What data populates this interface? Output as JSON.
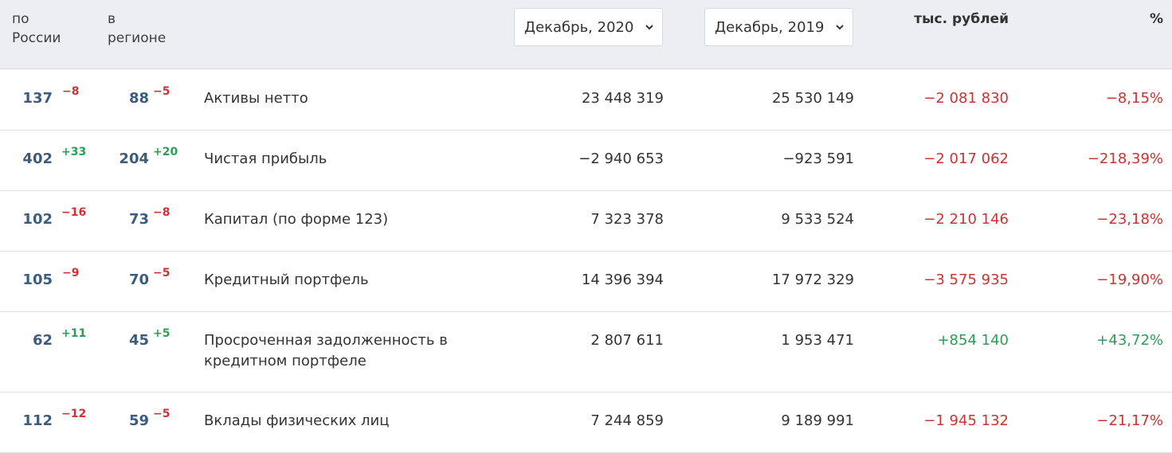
{
  "header": {
    "rank_russia_line1": "по",
    "rank_russia_line2": "России",
    "rank_region_line1": "в",
    "rank_region_line2": "регионе",
    "period_current": "Декабрь, 2020",
    "period_previous": "Декабрь, 2019",
    "delta_abs_label": "тыс. рублей",
    "delta_pct_label": "%"
  },
  "rows": [
    {
      "rank_ru": "137",
      "rank_ru_delta": "−8",
      "rank_reg": "88",
      "rank_reg_delta": "−5",
      "name": "Активы нетто",
      "current": "23 448 319",
      "previous": "25 530 149",
      "delta_abs": "−2 081 830",
      "delta_pct": "−8,15%"
    },
    {
      "rank_ru": "402",
      "rank_ru_delta": "+33",
      "rank_reg": "204",
      "rank_reg_delta": "+20",
      "name": "Чистая прибыль",
      "current": "−2 940 653",
      "previous": "−923 591",
      "delta_abs": "−2 017 062",
      "delta_pct": "−218,39%"
    },
    {
      "rank_ru": "102",
      "rank_ru_delta": "−16",
      "rank_reg": "73",
      "rank_reg_delta": "−8",
      "name": "Капитал (по форме 123)",
      "current": "7 323 378",
      "previous": "9 533 524",
      "delta_abs": "−2 210 146",
      "delta_pct": "−23,18%"
    },
    {
      "rank_ru": "105",
      "rank_ru_delta": "−9",
      "rank_reg": "70",
      "rank_reg_delta": "−5",
      "name": "Кредитный портфель",
      "current": "14 396 394",
      "previous": "17 972 329",
      "delta_abs": "−3 575 935",
      "delta_pct": "−19,90%"
    },
    {
      "rank_ru": "62",
      "rank_ru_delta": "+11",
      "rank_reg": "45",
      "rank_reg_delta": "+5",
      "name": "Просроченная задолженность в кредитном портфеле",
      "current": "2 807 611",
      "previous": "1 953 471",
      "delta_abs": "+854 140",
      "delta_pct": "+43,72%"
    },
    {
      "rank_ru": "112",
      "rank_ru_delta": "−12",
      "rank_reg": "59",
      "rank_reg_delta": "−5",
      "name": "Вклады физических лиц",
      "current": "7 244 859",
      "previous": "9 189 991",
      "delta_abs": "−1 945 132",
      "delta_pct": "−21,17%"
    }
  ],
  "colors": {
    "negative": "#cc3333",
    "positive": "#2c9e55",
    "rank": "#3b5c7e"
  }
}
